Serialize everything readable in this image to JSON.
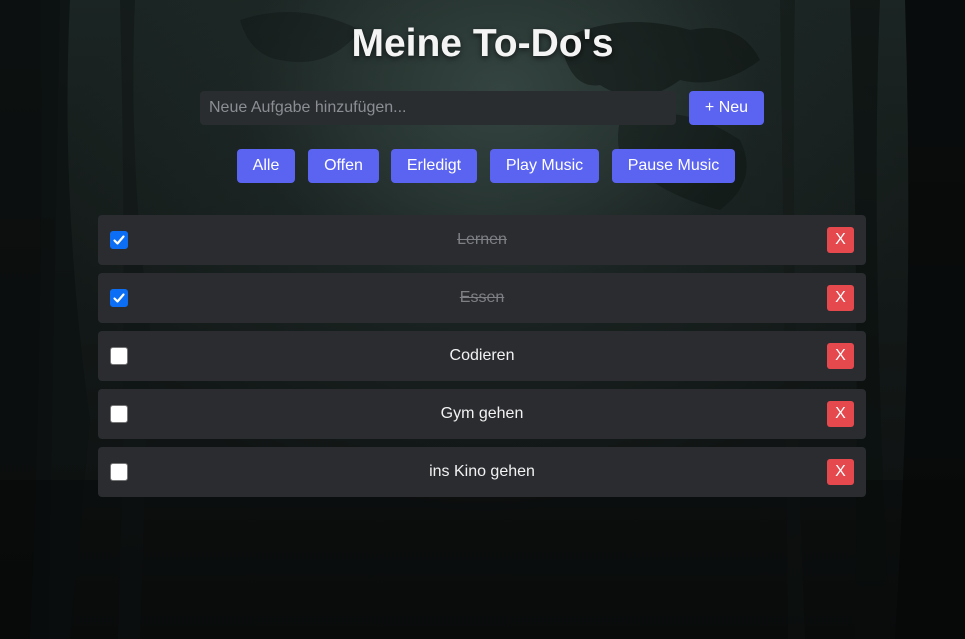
{
  "app": {
    "title": "Meine To-Do's"
  },
  "input": {
    "placeholder": "Neue Aufgabe hinzufügen...",
    "value": ""
  },
  "add_button": {
    "label": "+ Neu"
  },
  "filters": [
    {
      "label": "Alle"
    },
    {
      "label": "Offen"
    },
    {
      "label": "Erledigt"
    }
  ],
  "music": {
    "play_label": "Play Music",
    "pause_label": "Pause Music"
  },
  "todos": [
    {
      "text": "Lernen",
      "done": true,
      "delete_label": "X"
    },
    {
      "text": "Essen",
      "done": true,
      "delete_label": "X"
    },
    {
      "text": "Codieren",
      "done": false,
      "delete_label": "X"
    },
    {
      "text": "Gym gehen",
      "done": false,
      "delete_label": "X"
    },
    {
      "text": "ins Kino gehen",
      "done": false,
      "delete_label": "X"
    }
  ],
  "colors": {
    "accent": "#5b63f1",
    "delete": "#e5484d",
    "item_bg": "#2a2c30",
    "checked": "#0b6ef5"
  },
  "icons": {
    "checkmark": "checkmark-icon",
    "background": "forest-background"
  }
}
